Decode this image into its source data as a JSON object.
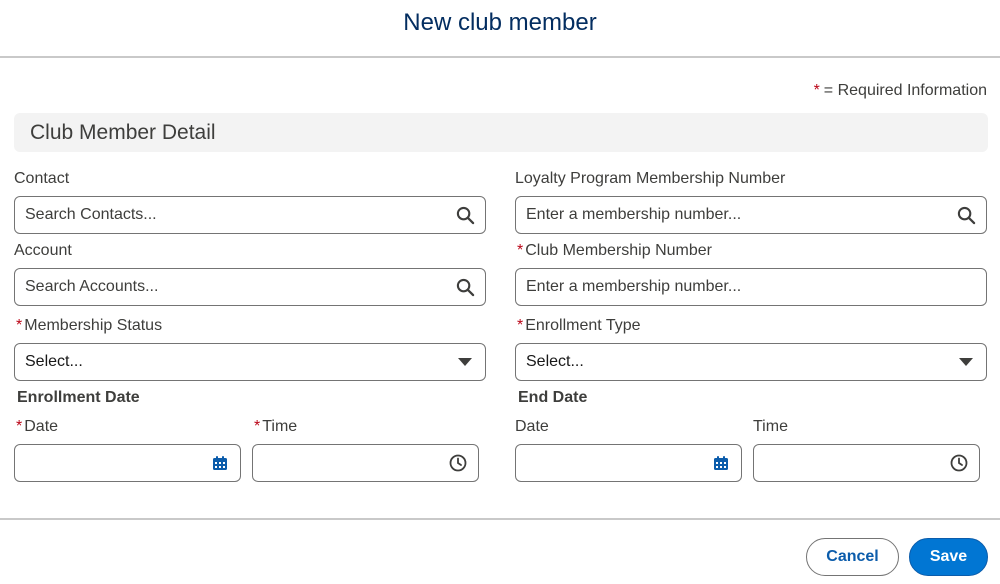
{
  "modal": {
    "title": "New club member"
  },
  "required_legend": {
    "star": "*",
    "text": "= Required Information"
  },
  "section": {
    "title": "Club Member Detail"
  },
  "fields": {
    "contact": {
      "label": "Contact",
      "placeholder": "Search Contacts...",
      "icon": "search-icon"
    },
    "loyalty_number": {
      "label": "Loyalty Program Membership Number",
      "placeholder": "Enter a membership number...",
      "icon": "search-icon"
    },
    "account": {
      "label": "Account",
      "placeholder": "Search Accounts...",
      "icon": "search-icon"
    },
    "club_number": {
      "label": "Club Membership Number",
      "required": true,
      "placeholder": "Enter a membership number..."
    },
    "membership_status": {
      "label": "Membership Status",
      "required": true,
      "value": "Select...",
      "icon": "caret-down-icon"
    },
    "enrollment_type": {
      "label": "Enrollment Type",
      "required": true,
      "value": "Select...",
      "icon": "caret-down-icon"
    }
  },
  "enrollment_date": {
    "heading": "Enrollment Date",
    "date_label": "Date",
    "time_label": "Time"
  },
  "end_date": {
    "heading": "End Date",
    "date_label": "Date",
    "time_label": "Time"
  },
  "footer": {
    "cancel_label": "Cancel",
    "save_label": "Save"
  },
  "colors": {
    "brand": "#0176d3",
    "title": "#032d60",
    "required": "#ba0517",
    "calendar_icon": "#0b5cab"
  }
}
